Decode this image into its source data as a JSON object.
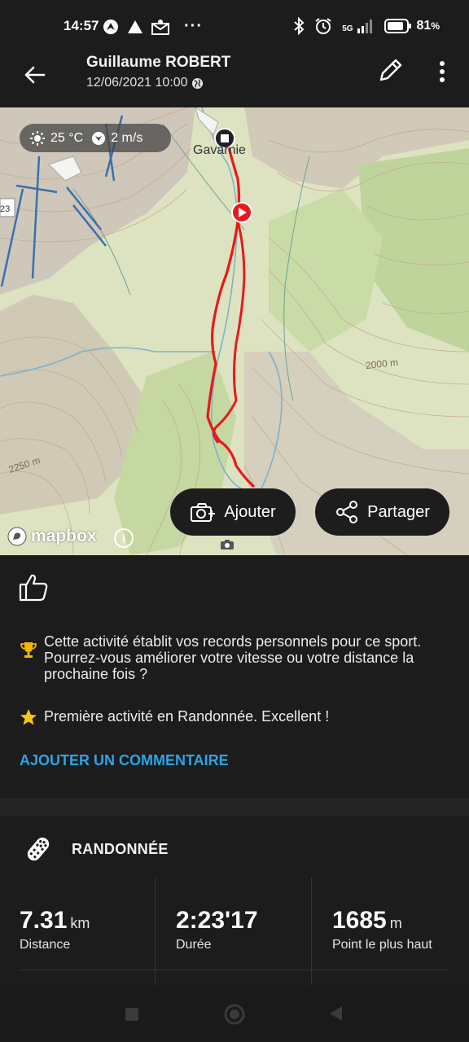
{
  "status_bar": {
    "time": "14:57",
    "dots": "···",
    "network": "5G",
    "battery": "81",
    "battery_unit": "%"
  },
  "header": {
    "name": "Guillaume ROBERT",
    "date": "12/06/2021 10:00",
    "back_icon": "arrow-left-icon",
    "edit_icon": "pencil-icon",
    "more_icon": "more-vertical-icon"
  },
  "map": {
    "weather": {
      "temp": "25 °C",
      "wind": "2 m/s"
    },
    "place": "Gavarnie",
    "edge_label": "23",
    "elevations": [
      "2000 m",
      "2250 m"
    ],
    "add_button": "Ajouter",
    "share_button": "Partager",
    "attribution": "mapbox",
    "info": "i",
    "route_color": "#e8191c"
  },
  "feed": {
    "record_text": "Cette activité établit vos records personnels pour ce sport. Pourrez-vous améliorer votre vitesse ou votre distance la prochaine fois ?",
    "first_text": "Première activité en Randonnée. Excellent !",
    "comment_link": "AJOUTER UN COMMENTAIRE"
  },
  "activity": {
    "sport": "RANDONNÉE",
    "stats": [
      {
        "value": "7.31",
        "unit": "km",
        "label": "Distance"
      },
      {
        "value": "2:23'17",
        "unit": "",
        "label": "Durée"
      },
      {
        "value": "1685",
        "unit": "m",
        "label": "Point le plus haut"
      }
    ]
  },
  "colors": {
    "accent_link": "#2fa3e4",
    "background": "#1c1c1c",
    "trophy": "#f5b400",
    "star": "#f5c518"
  }
}
